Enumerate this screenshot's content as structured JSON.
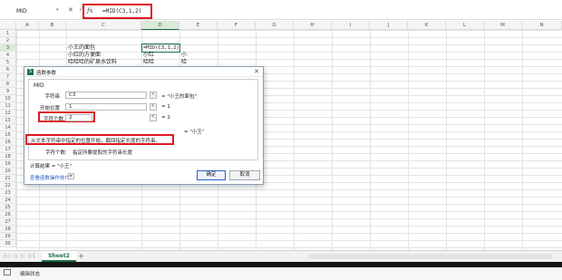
{
  "formula_bar": {
    "name_box": "MID",
    "cancel_icon": "✕",
    "confirm_icon": "✓",
    "fx_label": "fx",
    "formula": "=MID(C3,1,2)"
  },
  "columns": [
    "A",
    "B",
    "C",
    "D",
    "E",
    "F",
    "G",
    "H",
    "I",
    "J",
    "K",
    "L",
    "M",
    "N"
  ],
  "rows": [
    "1",
    "2",
    "3",
    "4",
    "5",
    "6",
    "7",
    "8",
    "9",
    "10",
    "11",
    "12",
    "13",
    "14",
    "15",
    "16",
    "17",
    "18",
    "19",
    "20",
    "21",
    "22",
    "23",
    "24",
    "25",
    "26",
    "27",
    "28",
    "29",
    "30"
  ],
  "cells": {
    "c3": "小王的面包",
    "c4": "小红的方便面",
    "c5": "哈哈哈的矿泉水饮料",
    "d3": "=MID(C3,1,2)",
    "d4": "小红",
    "d5": "哈哈",
    "e4": "小",
    "e5": "哈"
  },
  "dialog": {
    "title": "函数参数",
    "close": "✕",
    "function_name": "MID",
    "args": [
      {
        "label": "字符串",
        "value": "C3",
        "result": "= \"小王的面包\""
      },
      {
        "label": "开始位置",
        "value": "1",
        "result": "= 1"
      },
      {
        "label": "字符个数",
        "value": "2",
        "result": "= 2"
      }
    ],
    "overall_result": "= \"小王\"",
    "description": "从文本字符串中指定的位置开始，截回指定长度的字符串。",
    "arg_help_label": "字符个数:",
    "arg_help_text": "指定所要提取的字符串长度",
    "calc_result": "计算结果 = \"小王\"",
    "help_link": "查看函数操作技巧",
    "ok": "确定",
    "cancel": "取消"
  },
  "sheet_tabs": {
    "active": "Sheet2",
    "add": "+",
    "nav": [
      "|◁",
      "◁",
      "▷",
      "▷|"
    ]
  },
  "status": {
    "text": "编辑状态"
  },
  "colors": {
    "accent": "#1e7145",
    "highlight": "#e0191f",
    "link": "#2962c4"
  }
}
